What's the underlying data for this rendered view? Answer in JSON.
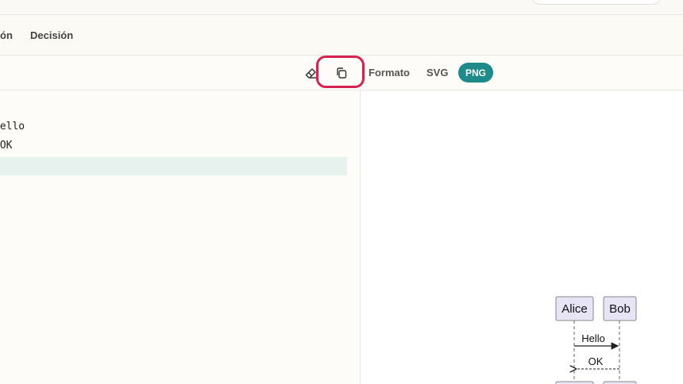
{
  "tabs": [
    {
      "label": "ón"
    },
    {
      "label": "Decisión"
    }
  ],
  "toolbar": {
    "clear_icon": "eraser-icon",
    "copy_icon": "copy-icon",
    "format_label": "Formato",
    "svg_label": "SVG",
    "png_label": "PNG",
    "colors": {
      "highlight": "#d4234f",
      "png_active": "#1e8a8a"
    }
  },
  "editor": {
    "lines": [
      "Hello",
      " OK"
    ]
  },
  "preview": {
    "participants": [
      "Alice",
      "Bob"
    ],
    "messages": [
      "Hello",
      "OK"
    ]
  }
}
